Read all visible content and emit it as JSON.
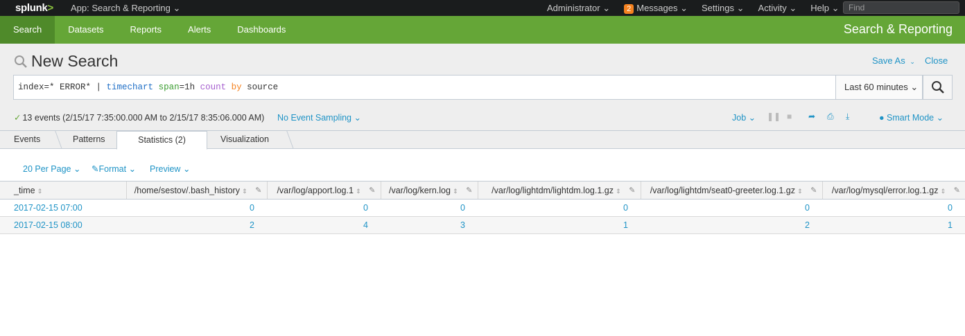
{
  "topbar": {
    "logo": "splunk",
    "logo_mark": ">",
    "app_switch": "App: Search & Reporting",
    "nav": [
      {
        "label": "Administrator"
      },
      {
        "label": "Messages",
        "badge": "2"
      },
      {
        "label": "Settings"
      },
      {
        "label": "Activity"
      },
      {
        "label": "Help"
      }
    ],
    "find_placeholder": "Find"
  },
  "appnav": {
    "items": [
      "Search",
      "Datasets",
      "Reports",
      "Alerts",
      "Dashboards"
    ],
    "active": "Search",
    "app_title": "Search & Reporting"
  },
  "search": {
    "title": "New Search",
    "save_as": "Save As",
    "close": "Close",
    "query": {
      "p1": "index=* ERROR* | ",
      "cmd": "timechart",
      "p2": " ",
      "arg": "span",
      "p3": "=1h ",
      "fn": "count",
      "p4": " ",
      "kw": "by",
      "p5": " source"
    },
    "time_range": "Last 60 minutes",
    "status": "13 events (2/15/17 7:35:00.000 AM to 2/15/17 8:35:06.000 AM)",
    "sampling": "No Event Sampling",
    "job": "Job",
    "mode": "Smart Mode"
  },
  "tabs": [
    "Events",
    "Patterns",
    "Statistics (2)",
    "Visualization"
  ],
  "active_tab": "Statistics (2)",
  "controls": {
    "per_page": "20 Per Page",
    "format": "Format",
    "preview": "Preview"
  },
  "table": {
    "columns": [
      "_time",
      "/home/sestov/.bash_history",
      "/var/log/apport.log.1",
      "/var/log/kern.log",
      "/var/log/lightdm/lightdm.log.1.gz",
      "/var/log/lightdm/seat0-greeter.log.1.gz",
      "/var/log/mysql/error.log.1.gz"
    ],
    "rows": [
      [
        "2017-02-15 07:00",
        "0",
        "0",
        "0",
        "0",
        "0",
        "0"
      ],
      [
        "2017-02-15 08:00",
        "2",
        "4",
        "3",
        "1",
        "2",
        "1"
      ]
    ]
  },
  "colors": {
    "topbar": "#1a1c1d",
    "green": "#65a637",
    "link": "#1e93c6",
    "badge": "#f58220"
  }
}
